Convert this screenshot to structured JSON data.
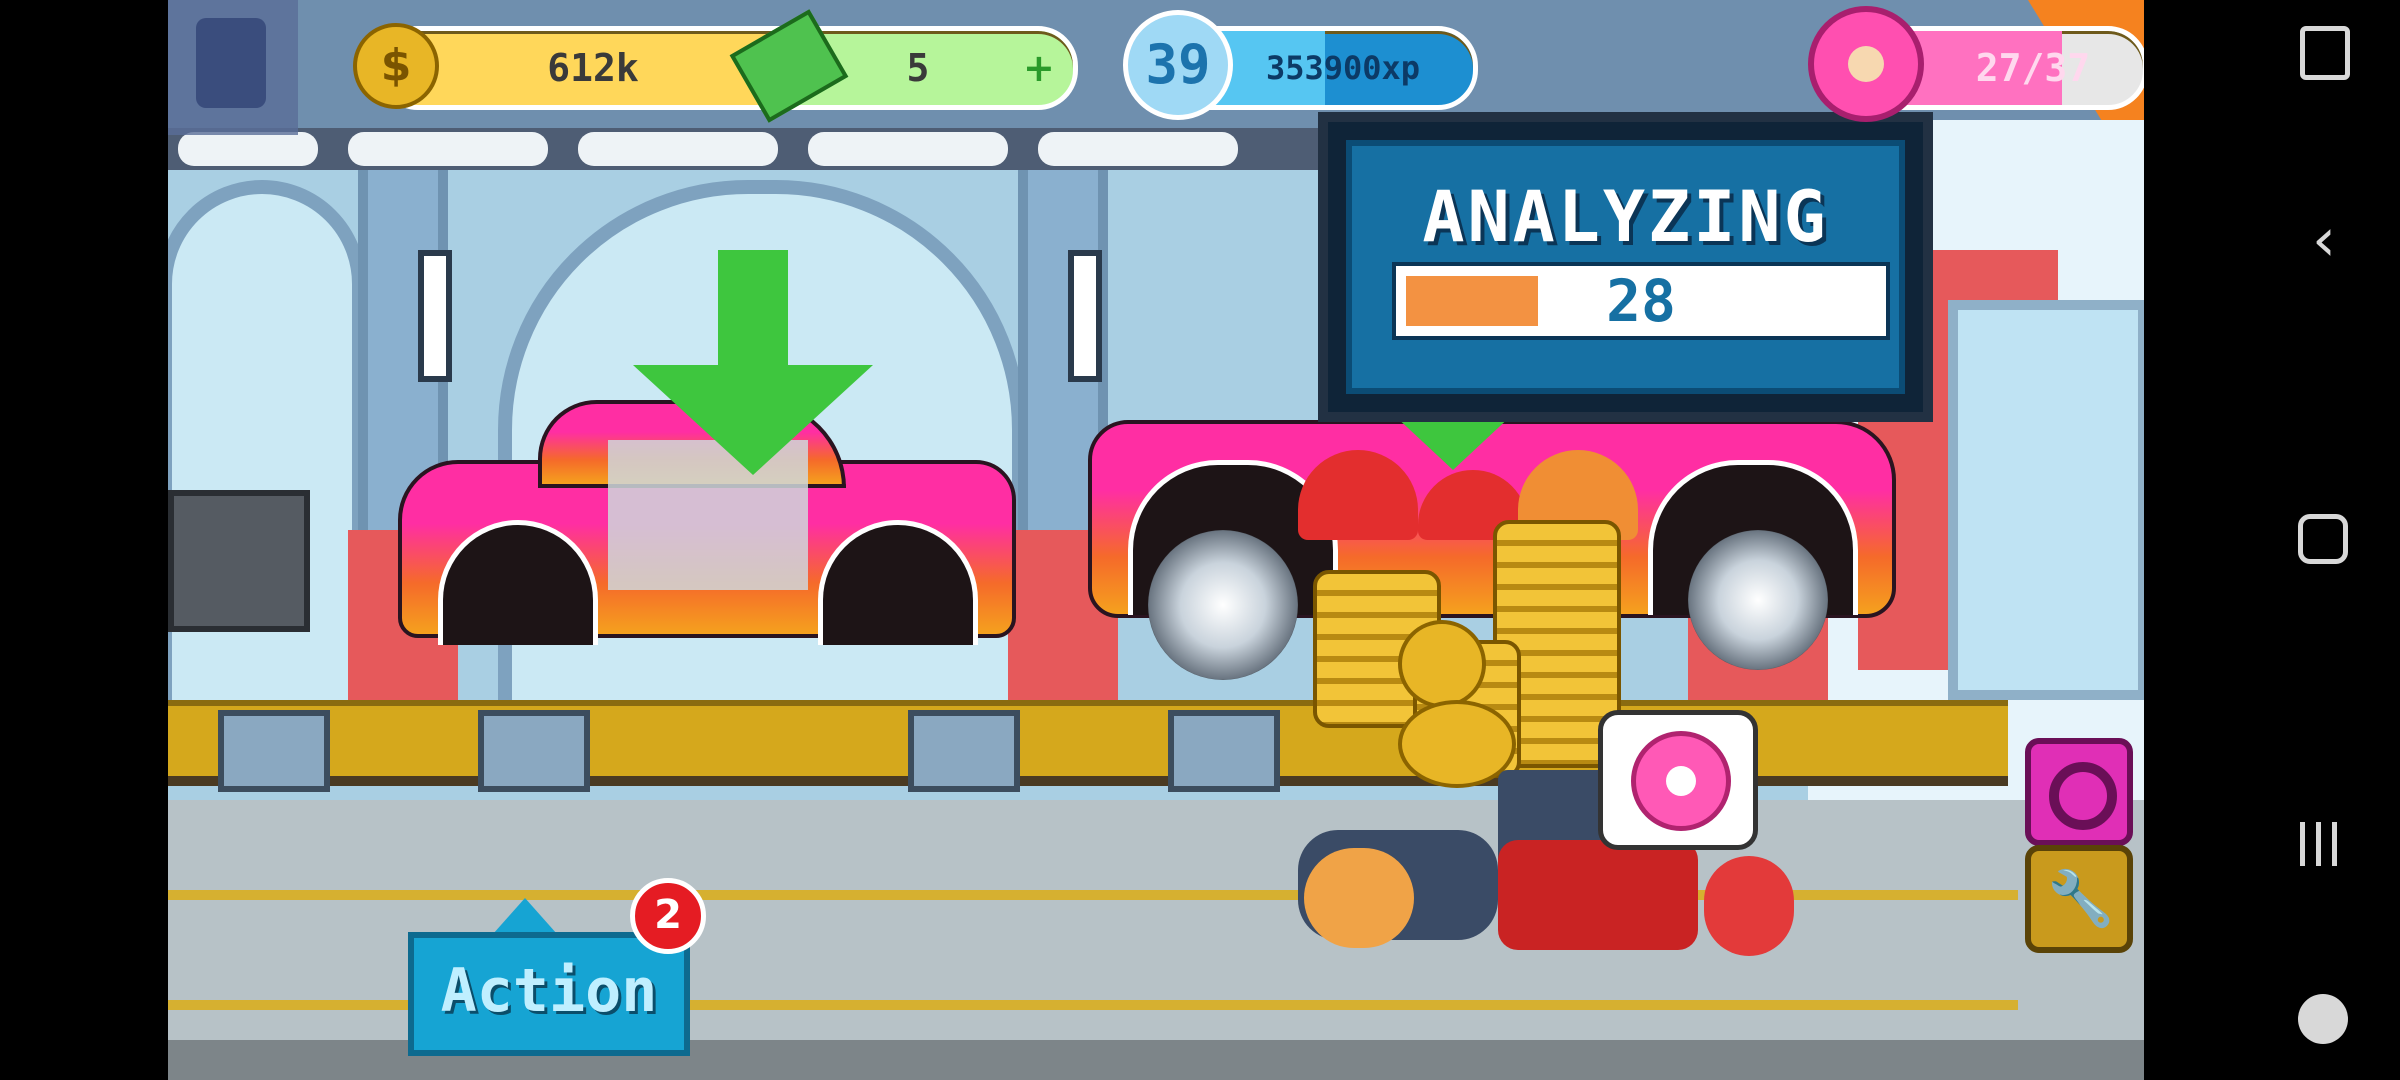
{
  "hud": {
    "coins": "612k",
    "cash": "5",
    "level": "39",
    "xp": "353900xp",
    "xp_progress": 0.55,
    "donuts": "27/37",
    "donut_progress": 0.73
  },
  "analyzing": {
    "title": "ANALYZING",
    "value": "28",
    "progress": 0.28
  },
  "action": {
    "label": "Action",
    "badge": "2"
  },
  "colors": {
    "coin_gold": "#e8b626",
    "cash_green": "#4fc24f",
    "xp_blue": "#2fa3e0",
    "donut_pink": "#ff4fb0",
    "action_blue": "#16a4d3",
    "badge_red": "#e51c23",
    "panel_blue": "#1670a3",
    "progress_orange": "#f39242"
  },
  "icons": {
    "coin": "dollar-coin-icon",
    "cash": "cash-bill-icon",
    "level": "level-star-icon",
    "donut": "donut-icon",
    "donut_button": "donut-ring-icon",
    "wrench": "wrench-icon"
  }
}
